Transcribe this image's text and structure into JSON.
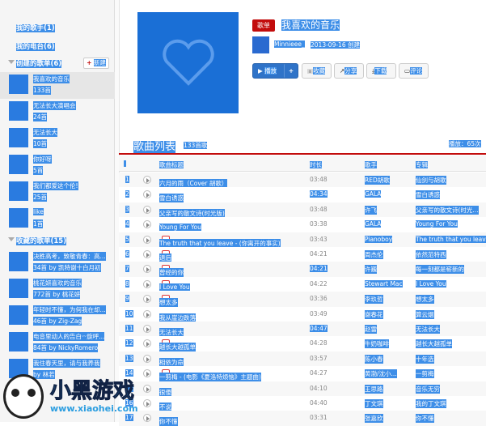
{
  "sidebar": {
    "my_singers": "我的歌手(1)",
    "my_radio": "我的电台(6)",
    "created_header": "创建的歌单(6)",
    "new_button": "新建",
    "created": [
      {
        "name": "我喜欢的音乐",
        "count": "133首"
      },
      {
        "name": "无法长大演唱会",
        "count": "24首"
      },
      {
        "name": "无法长大",
        "count": "10首"
      },
      {
        "name": "你好呀",
        "count": "5首"
      },
      {
        "name": "我们都爱这个伦!",
        "count": "25首"
      },
      {
        "name": "like",
        "count": "1首"
      }
    ],
    "collected_header": "收藏的歌单(15)",
    "collected": [
      {
        "name": "决胜高考，致敬青春：高...",
        "count": "34首 by 凯特谢十白月初"
      },
      {
        "name": "桃花妍喜欢的音乐",
        "count": "772首 by 桃花妍"
      },
      {
        "name": "年轻时不懂，为何我在却...",
        "count": "46首 by Zig-Zag"
      },
      {
        "name": "电音里动人的告白ᵕᵕ旋呼...",
        "count": "84首 by NickyRomero"
      },
      {
        "name": "我住春天里，请与我养我",
        "count": "by 林若"
      }
    ]
  },
  "header": {
    "tag": "歌单",
    "title": "我喜欢的音乐",
    "user": "Minnieee_",
    "date": "2013-09-16 创建",
    "buttons": {
      "play": "播放",
      "add": "+",
      "collect": "收藏",
      "share": "分享",
      "download": "下载",
      "comment": "评论"
    }
  },
  "list": {
    "title": "歌曲列表",
    "count": "133首歌",
    "plays": "播放：65次",
    "columns": {
      "title": "歌曲标题",
      "duration": "时长",
      "artist": "歌手",
      "album": "专辑"
    },
    "rows": [
      {
        "n": "1",
        "title": "六月的雨（Cover 胡歌）",
        "mv": false,
        "dur": "03:48",
        "artist": "RED胡歌",
        "album": "仙剑与胡歌"
      },
      {
        "n": "2",
        "title": "雪白诱惑",
        "mv": false,
        "dur": "04:34",
        "artist": "GALA",
        "album": "雪白诱惑"
      },
      {
        "n": "3",
        "title": "父亲写的散文诗(时光版)",
        "mv": false,
        "dur": "03:48",
        "artist": "许飞",
        "album": "父亲写的散文诗(时光..."
      },
      {
        "n": "4",
        "title": "Young For You",
        "mv": false,
        "dur": "03:38",
        "artist": "GALA",
        "album": "Young For You"
      },
      {
        "n": "5",
        "title": "The truth that you leave - (你离开的事实)",
        "mv": true,
        "dur": "03:43",
        "artist": "Pianoboy",
        "album": "The truth that you leave"
      },
      {
        "n": "6",
        "title": "退后",
        "mv": true,
        "dur": "04:21",
        "artist": "周杰伦",
        "album": "依然范特西"
      },
      {
        "n": "7",
        "title": "曾经的你",
        "mv": true,
        "dur": "04:21",
        "artist": "许巍",
        "album": "每一刻都是崭新的"
      },
      {
        "n": "8",
        "title": "I Love You",
        "mv": true,
        "dur": "04:22",
        "artist": "Stewart Mac",
        "album": "I Love You"
      },
      {
        "n": "9",
        "title": "想太多",
        "mv": true,
        "dur": "03:36",
        "artist": "李玖哲",
        "album": "想太多"
      },
      {
        "n": "10",
        "title": "我从崖边跌落",
        "mv": false,
        "dur": "03:49",
        "artist": "谢春花",
        "album": "算云烟"
      },
      {
        "n": "11",
        "title": "无法长大",
        "mv": false,
        "dur": "04:47",
        "artist": "赵雷",
        "album": "无法长大"
      },
      {
        "n": "12",
        "title": "越长大越孤单",
        "mv": true,
        "dur": "04:28",
        "artist": "牛奶咖啡",
        "album": "越长大越孤单"
      },
      {
        "n": "13",
        "title": "相依为命",
        "mv": false,
        "dur": "03:57",
        "artist": "陈小春",
        "album": "十年选"
      },
      {
        "n": "14",
        "title": "一剪梅 - (电影《夏洛特烦恼》主题曲)",
        "mv": true,
        "dur": "04:27",
        "artist": "黄渤/沈小...",
        "album": "一剪梅"
      },
      {
        "n": "15",
        "title": "很傻",
        "mv": false,
        "dur": "04:10",
        "artist": "王思路",
        "album": "音乐无穷"
      },
      {
        "n": "16",
        "title": "不说",
        "mv": false,
        "dur": "04:40",
        "artist": "丁文琪",
        "album": "我的丁文琪"
      },
      {
        "n": "17",
        "title": "你不懂",
        "mv": false,
        "dur": "03:31",
        "artist": "张嘉欣",
        "album": "你不懂"
      }
    ]
  },
  "watermark": {
    "text": "小黑游戏",
    "url": "www.xiaohei.com"
  }
}
